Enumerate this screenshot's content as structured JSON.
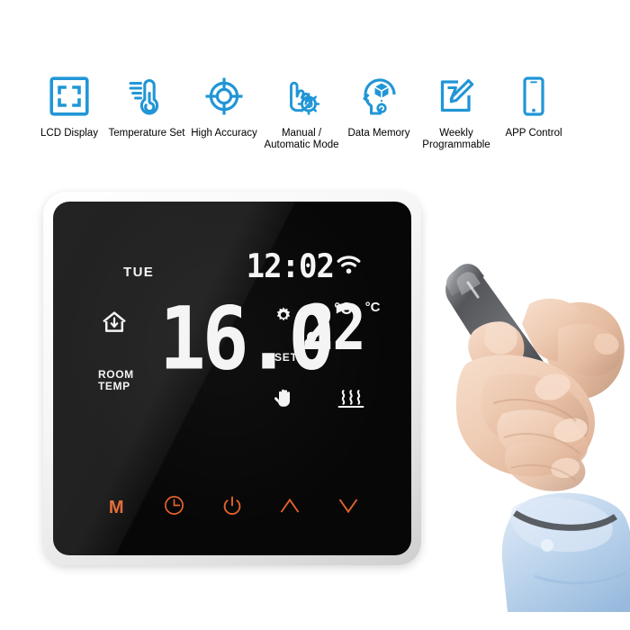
{
  "features": [
    {
      "label": "LCD Display",
      "icon": "lcd-display-icon"
    },
    {
      "label": "Temperature Set",
      "icon": "thermometer-icon"
    },
    {
      "label": "High Accuracy",
      "icon": "crosshair-target-icon"
    },
    {
      "label": "Manual /\nAutomatic Mode",
      "icon": "hand-gear-icon"
    },
    {
      "label": "Data Memory",
      "icon": "head-memory-icon"
    },
    {
      "label": "Weekly\nProgrammable",
      "icon": "notepad-pencil-icon"
    },
    {
      "label": "APP Control",
      "icon": "smartphone-icon"
    }
  ],
  "thermostat": {
    "lcd": {
      "day": "TUE",
      "time": "12:02",
      "wifi_icon": "wifi-icon",
      "home_icon": "house-indoor-temp-icon",
      "room_temp_label": "ROOM\nTEMP",
      "room_temp_value": "16.0",
      "room_temp_unit": "°C",
      "gear_icon": "gear-icon",
      "set_label": "SET",
      "set_temp_value": "22",
      "set_temp_unit": "°C",
      "manual_icon": "hand-manual-icon",
      "heating_icon": "heating-waves-icon"
    },
    "buttons": [
      {
        "name": "mode-button",
        "label": "M",
        "icon": "letter-m-icon"
      },
      {
        "name": "clock-button",
        "label": "",
        "icon": "clock-icon"
      },
      {
        "name": "power-button",
        "label": "",
        "icon": "power-icon"
      },
      {
        "name": "up-button",
        "label": "",
        "icon": "chevron-up-icon"
      },
      {
        "name": "down-button",
        "label": "",
        "icon": "chevron-down-icon"
      }
    ]
  },
  "photo": {
    "hand_phone_alt": "hand-holding-smartphone"
  },
  "colors": {
    "accent_blue": "#2196d6",
    "button_orange": "#e2622b",
    "lcd_white": "#f4f4f4",
    "screen_black": "#070707",
    "bezel_white": "#ffffff",
    "page_background": "#ffffff"
  }
}
